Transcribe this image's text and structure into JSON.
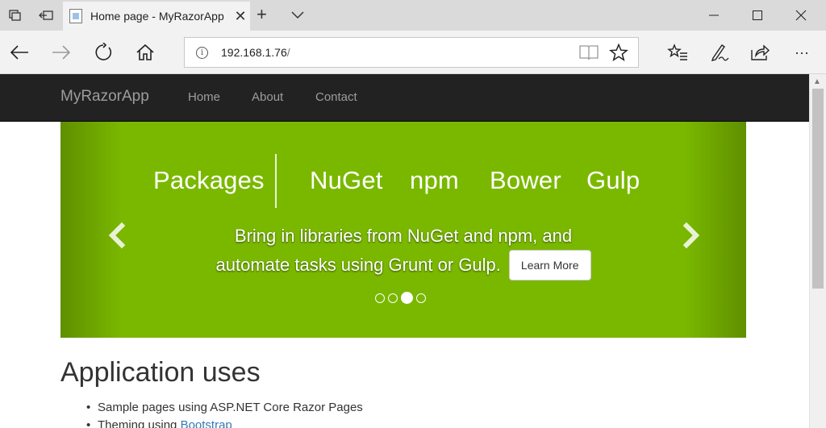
{
  "browser": {
    "tab": {
      "title": "Home page - MyRazorApp",
      "close": "✕"
    },
    "new_tab": "+",
    "address": {
      "url": "192.168.1.76",
      "url_suffix": "/"
    },
    "icons": {
      "tab_actions": "tab-actions-icon",
      "set_aside": "set-aside-icon",
      "back": "back-arrow-icon",
      "forward": "forward-arrow-icon",
      "refresh": "refresh-icon",
      "home": "home-icon",
      "info": "i",
      "reading_view": "book-icon",
      "favorite": "star-icon",
      "favorites_hub": "hub-icon",
      "notes": "pen-icon",
      "share": "share-icon",
      "more": "···"
    },
    "window": {
      "minimize": "—",
      "maximize": "☐",
      "close": "✕"
    }
  },
  "site": {
    "brand": "MyRazorApp",
    "nav": [
      "Home",
      "About",
      "Contact"
    ]
  },
  "carousel": {
    "heading": "Packages",
    "tools": [
      "NuGet",
      "npm",
      "Bower",
      "Gulp"
    ],
    "caption_line1": "Bring in libraries from NuGet and npm, and",
    "caption_line2": "automate tasks using Grunt or Gulp.",
    "button": "Learn More",
    "slide_count": 4,
    "active_slide": 3,
    "colors": {
      "background": "#7ab800",
      "edge": "#5f8f00"
    }
  },
  "content": {
    "title": "Application uses",
    "items": [
      {
        "text": "Sample pages using ASP.NET Core Razor Pages",
        "link": ""
      },
      {
        "text": "Theming using ",
        "link": "Bootstrap"
      }
    ]
  }
}
